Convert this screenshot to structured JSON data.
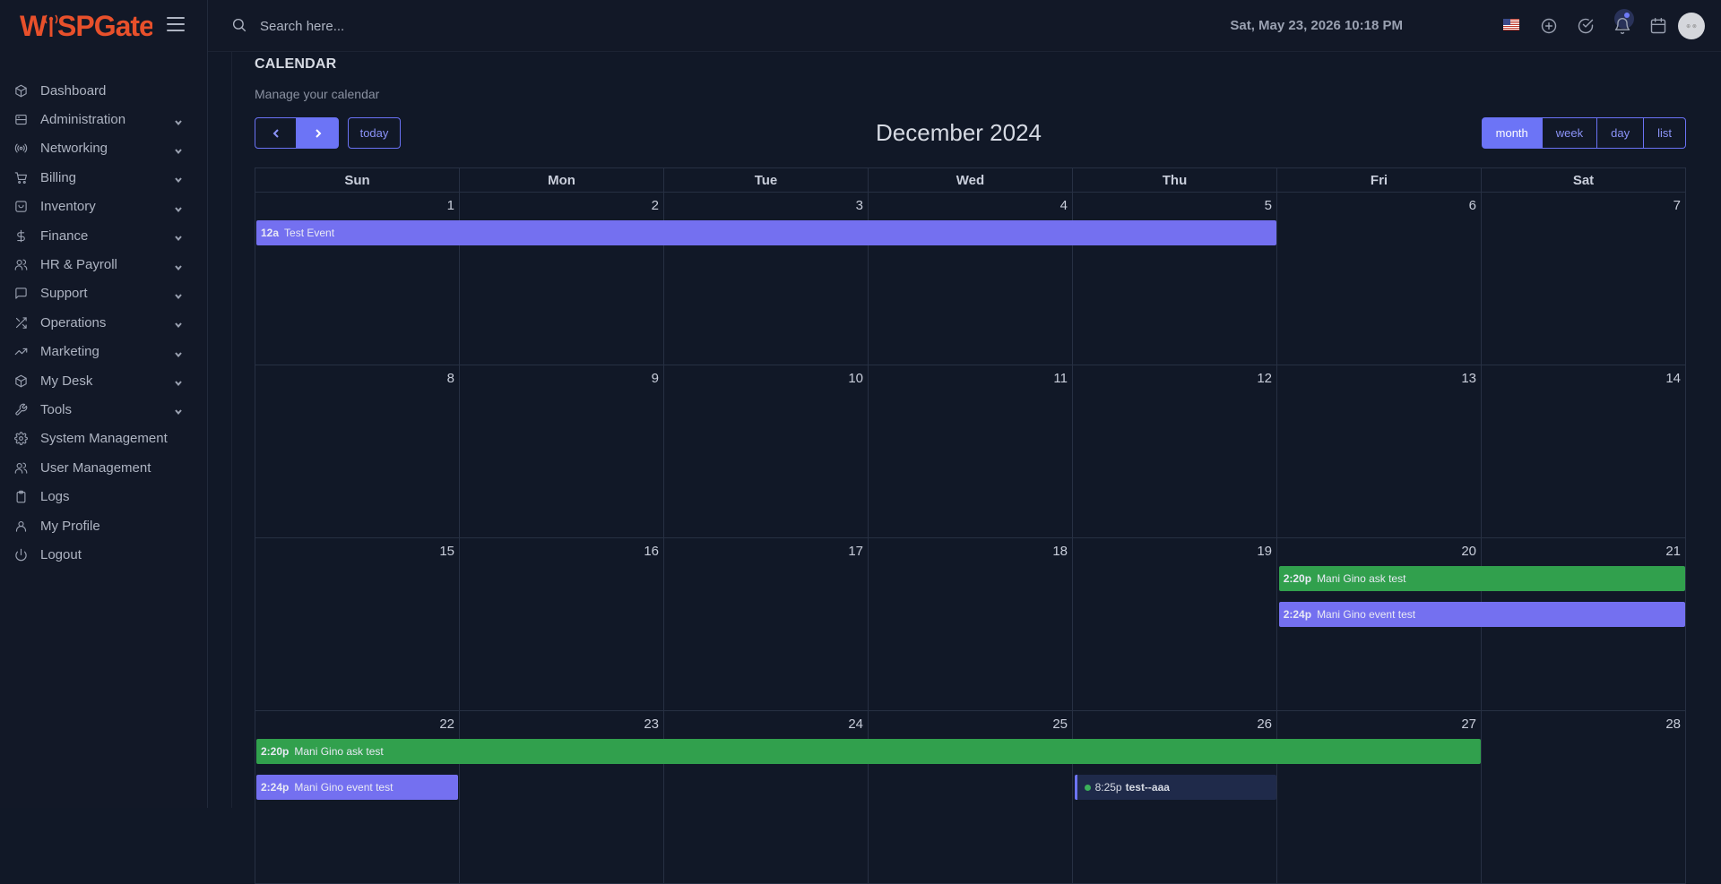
{
  "app": {
    "logo_text_1": "W",
    "logo_text_2": "SPGate",
    "logo_text_mid": "i"
  },
  "sidebar": {
    "items": [
      {
        "label": "Dashboard",
        "icon": "cube-icon",
        "expandable": false
      },
      {
        "label": "Administration",
        "icon": "server-icon",
        "expandable": true
      },
      {
        "label": "Networking",
        "icon": "broadcast-icon",
        "expandable": true
      },
      {
        "label": "Billing",
        "icon": "cart-icon",
        "expandable": true
      },
      {
        "label": "Inventory",
        "icon": "archive-icon",
        "expandable": true
      },
      {
        "label": "Finance",
        "icon": "dollar-icon",
        "expandable": true
      },
      {
        "label": "HR & Payroll",
        "icon": "users-icon",
        "expandable": true
      },
      {
        "label": "Support",
        "icon": "chat-icon",
        "expandable": true
      },
      {
        "label": "Operations",
        "icon": "shuffle-icon",
        "expandable": true
      },
      {
        "label": "Marketing",
        "icon": "trending-icon",
        "expandable": true
      },
      {
        "label": "My Desk",
        "icon": "box-icon",
        "expandable": true
      },
      {
        "label": "Tools",
        "icon": "wrench-icon",
        "expandable": true
      },
      {
        "label": "System Management",
        "icon": "gear-icon",
        "expandable": false
      },
      {
        "label": "User Management",
        "icon": "users-icon",
        "expandable": false
      },
      {
        "label": "Logs",
        "icon": "clipboard-icon",
        "expandable": false
      },
      {
        "label": "My Profile",
        "icon": "user-icon",
        "expandable": false
      },
      {
        "label": "Logout",
        "icon": "power-icon",
        "expandable": false
      }
    ]
  },
  "topbar": {
    "search_placeholder": "Search here...",
    "datetime": "Sat, May 23, 2026 10:18 PM",
    "avatar_text": "⊕ ⊗"
  },
  "page": {
    "title": "CALENDAR",
    "subtitle": "Manage your calendar"
  },
  "calendar": {
    "title": "December 2024",
    "today_label": "today",
    "views": [
      {
        "label": "month",
        "active": true
      },
      {
        "label": "week",
        "active": false
      },
      {
        "label": "day",
        "active": false
      },
      {
        "label": "list",
        "active": false
      }
    ],
    "weekdays": [
      "Sun",
      "Mon",
      "Tue",
      "Wed",
      "Thu",
      "Fri",
      "Sat"
    ],
    "weeks": [
      {
        "days": [
          "1",
          "2",
          "3",
          "4",
          "5",
          "6",
          "7"
        ],
        "events": [
          {
            "time": "12a",
            "title": "Test Event",
            "start": 0,
            "span": 5,
            "row": 0,
            "color": "purple"
          }
        ]
      },
      {
        "days": [
          "8",
          "9",
          "10",
          "11",
          "12",
          "13",
          "14"
        ],
        "events": []
      },
      {
        "days": [
          "15",
          "16",
          "17",
          "18",
          "19",
          "20",
          "21"
        ],
        "events": [
          {
            "time": "2:20p",
            "title": "Mani Gino ask test",
            "start": 5,
            "span": 2,
            "row": 0,
            "color": "green"
          },
          {
            "time": "2:24p",
            "title": "Mani Gino event test",
            "start": 5,
            "span": 2,
            "row": 1,
            "color": "purple"
          }
        ]
      },
      {
        "days": [
          "22",
          "23",
          "24",
          "25",
          "26",
          "27",
          "28"
        ],
        "events": [
          {
            "time": "2:20p",
            "title": "Mani Gino ask test",
            "start": 0,
            "span": 6,
            "row": 0,
            "color": "green"
          },
          {
            "time": "2:24p",
            "title": "Mani Gino event test",
            "start": 0,
            "span": 1,
            "row": 1,
            "color": "purple"
          },
          {
            "time": "8:25p",
            "title": "test--aaa",
            "start": 4,
            "span": 1,
            "row": 1,
            "color": "dark"
          }
        ]
      }
    ]
  }
}
